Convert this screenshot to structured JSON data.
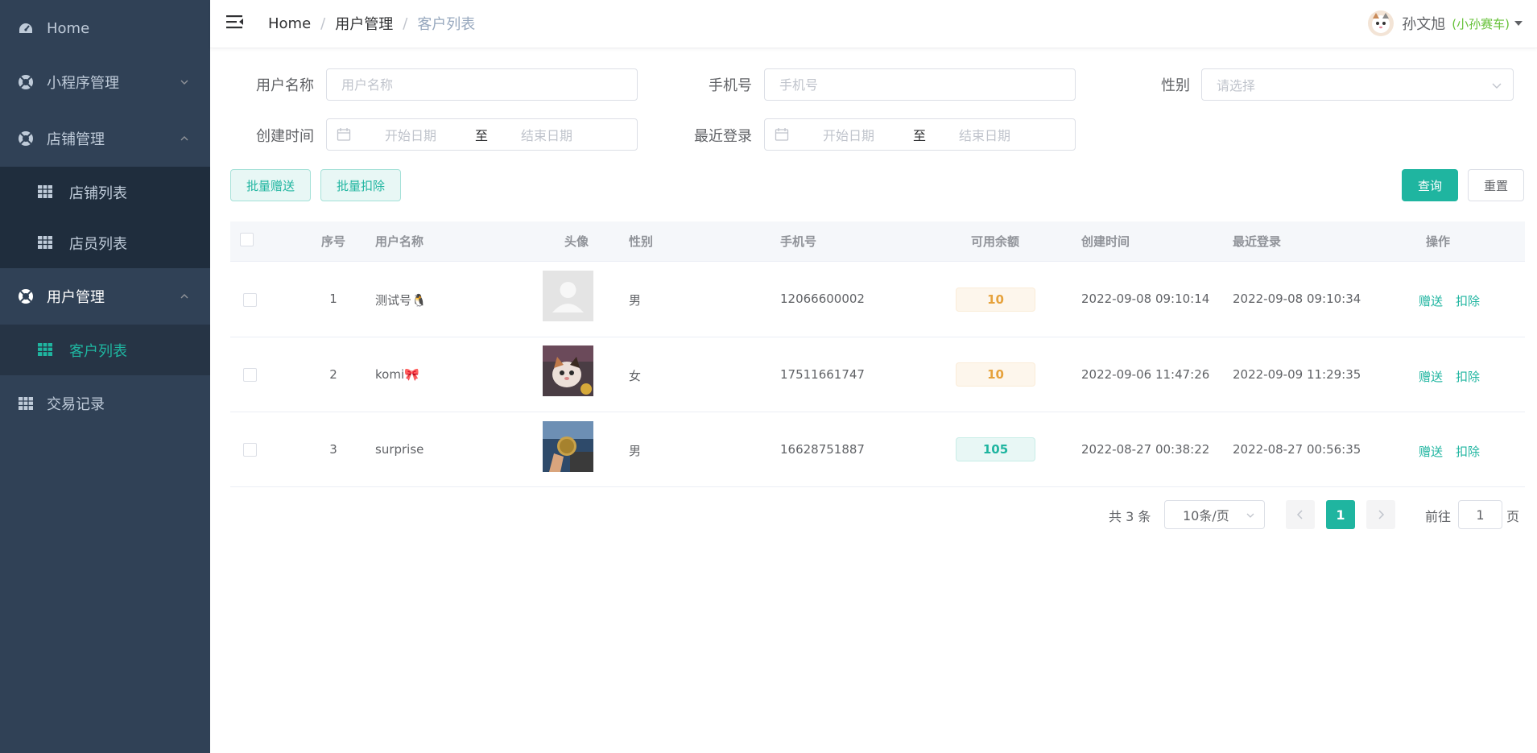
{
  "sidebar": {
    "home": "Home",
    "miniapp": "小程序管理",
    "store": "店铺管理",
    "store_list": "店铺列表",
    "staff_list": "店员列表",
    "users": "用户管理",
    "customer_list": "客户列表",
    "transactions": "交易记录",
    "active_color": "#1fb5a0"
  },
  "header": {
    "breadcrumb": [
      "Home",
      "用户管理",
      "客户列表"
    ],
    "separator": "/",
    "user_name": "孙文旭",
    "user_nick": "(小孙赛车)"
  },
  "filters": {
    "username_label": "用户名称",
    "username_placeholder": "用户名称",
    "phone_label": "手机号",
    "phone_placeholder": "手机号",
    "gender_label": "性别",
    "gender_placeholder": "请选择",
    "created_label": "创建时间",
    "lastlogin_label": "最近登录",
    "start_placeholder": "开始日期",
    "range_sep": "至",
    "end_placeholder": "结束日期"
  },
  "actions": {
    "batch_gift": "批量赠送",
    "batch_deduct": "批量扣除",
    "query": "查询",
    "reset": "重置"
  },
  "table": {
    "columns": [
      "序号",
      "用户名称",
      "头像",
      "性别",
      "手机号",
      "可用余额",
      "创建时间",
      "最近登录",
      "操作"
    ],
    "rows": [
      {
        "index": "1",
        "name": "测试号🐧",
        "avatar": "default-avatar",
        "gender": "男",
        "phone": "12066600002",
        "balance": "10",
        "balance_style": "warn",
        "created": "2022-09-08 09:10:14",
        "last_login": "2022-09-08 09:10:34",
        "op_gift": "赠送",
        "op_deduct": "扣除"
      },
      {
        "index": "2",
        "name": "komi🎀",
        "avatar": "cat-avatar",
        "gender": "女",
        "phone": "17511661747",
        "balance": "10",
        "balance_style": "warn",
        "created": "2022-09-06 11:47:26",
        "last_login": "2022-09-09 11:29:35",
        "op_gift": "赠送",
        "op_deduct": "扣除"
      },
      {
        "index": "3",
        "name": "surprise",
        "avatar": "coin-avatar",
        "gender": "男",
        "phone": "16628751887",
        "balance": "105",
        "balance_style": "info",
        "created": "2022-08-27 00:38:22",
        "last_login": "2022-08-27 00:56:35",
        "op_gift": "赠送",
        "op_deduct": "扣除"
      }
    ]
  },
  "pagination": {
    "total": "共 3 条",
    "page_size": "10条/页",
    "current": "1",
    "goto_prefix": "前往",
    "goto_value": "1",
    "goto_suffix": "页"
  }
}
